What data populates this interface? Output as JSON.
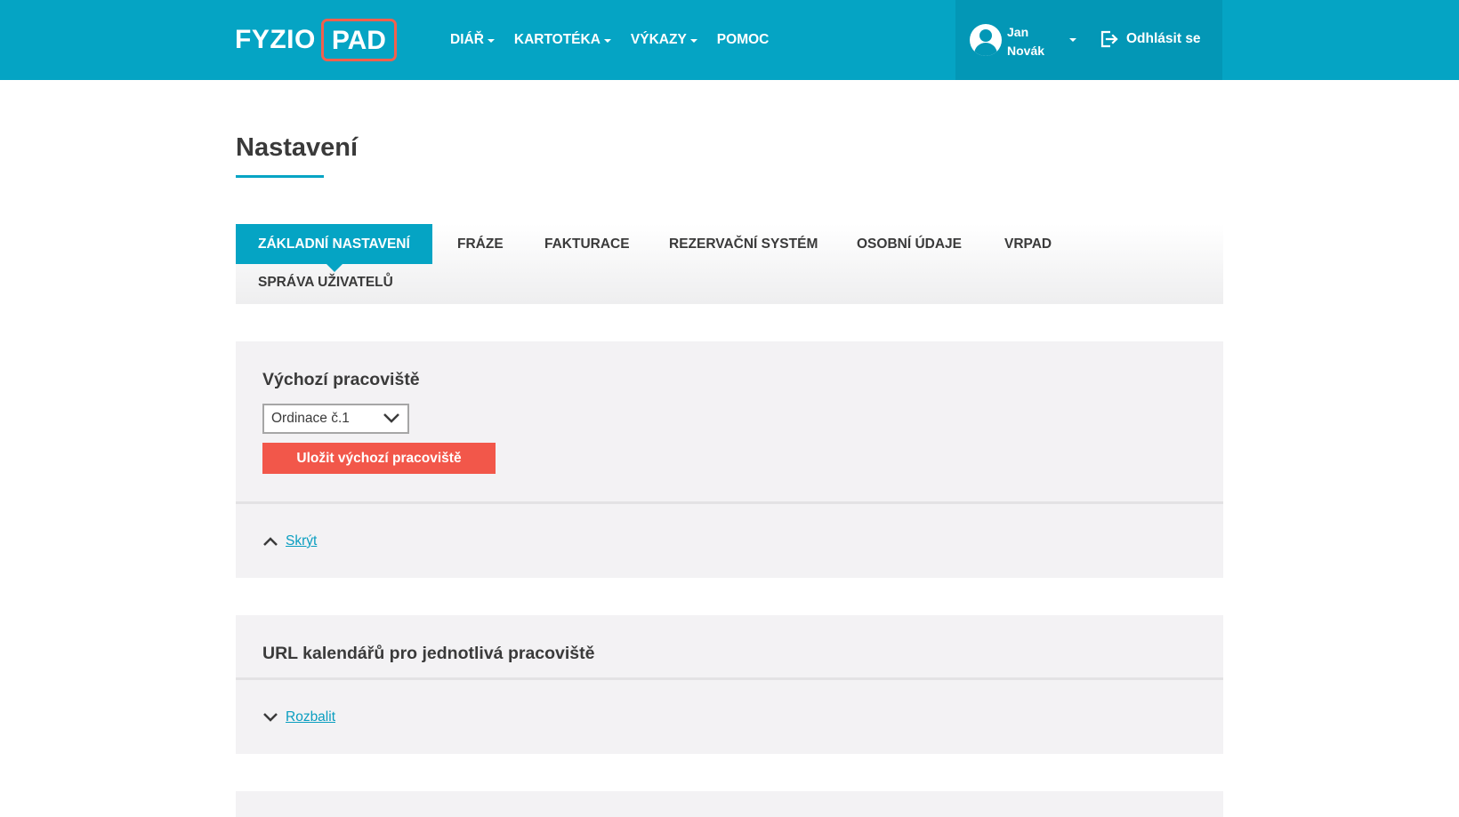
{
  "header": {
    "logo_left": "FYZIO",
    "logo_right": "PAD",
    "nav": [
      {
        "label": "DIÁŘ",
        "has_dropdown": true
      },
      {
        "label": "KARTOTÉKA",
        "has_dropdown": true
      },
      {
        "label": "VÝKAZY",
        "has_dropdown": true
      },
      {
        "label": "POMOC",
        "has_dropdown": false
      }
    ],
    "user": {
      "first_name": "Jan",
      "last_name": "Novák"
    },
    "logout_label": "Odhlásit se"
  },
  "page": {
    "title": "Nastavení"
  },
  "tabs": [
    {
      "label": "ZÁKLADNÍ NASTAVENÍ",
      "active": true
    },
    {
      "label": "FRÁZE",
      "active": false
    },
    {
      "label": "FAKTURACE",
      "active": false
    },
    {
      "label": "REZERVAČNÍ SYSTÉM",
      "active": false
    },
    {
      "label": "OSOBNÍ ÚDAJE",
      "active": false
    },
    {
      "label": "VRPAD",
      "active": false
    },
    {
      "label": "SPRÁVA UŽIVATELŮ",
      "active": false
    }
  ],
  "panels": {
    "default_workplace": {
      "heading": "Výchozí pracoviště",
      "select_value": "Ordinace č.1",
      "save_label": "Uložit výchozí pracoviště",
      "toggle_label": "Skrýt"
    },
    "calendar_urls": {
      "heading": "URL kalendářů pro jednotlivá pracoviště",
      "toggle_label": "Rozbalit"
    }
  },
  "colors": {
    "header_bg": "#05a4c4",
    "user_area_bg": "#0397b6",
    "accent_red": "#f2574a",
    "link": "#0a9ec0",
    "panel_bg": "#f3f2f4"
  }
}
